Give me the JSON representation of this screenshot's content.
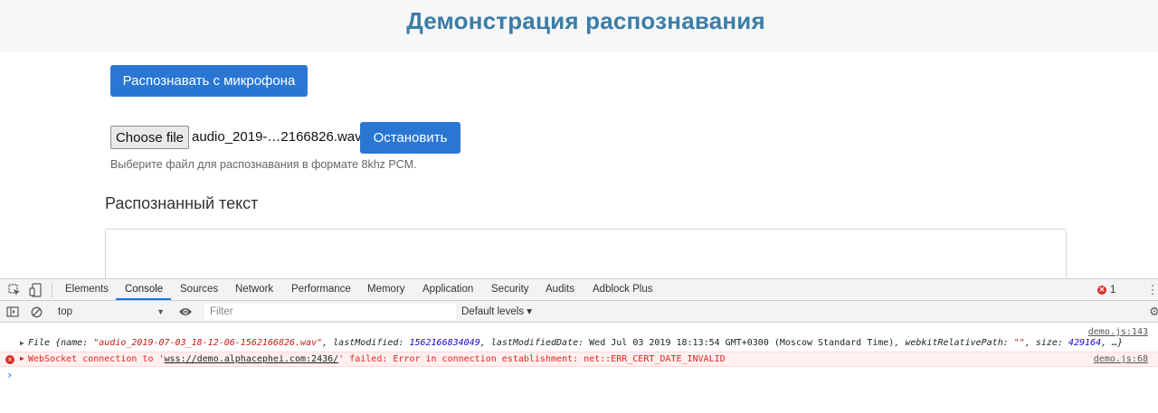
{
  "page": {
    "title": "Демонстрация распознавания",
    "mic_button": "Распознавать с микрофона",
    "choose_file_button": "Choose file",
    "file_name": "audio_2019-…2166826.wav",
    "stop_button": "Остановить",
    "file_hint": "Выберите файл для распознавания в формате 8khz PCM.",
    "result_heading": "Распознанный текст",
    "result_text": ""
  },
  "devtools": {
    "tabs": [
      "Elements",
      "Console",
      "Sources",
      "Network",
      "Performance",
      "Memory",
      "Application",
      "Security",
      "Audits",
      "Adblock Plus"
    ],
    "active_tab": "Console",
    "error_count": "1",
    "toolbar": {
      "context": "top",
      "filter_placeholder": "Filter",
      "levels": "Default levels ▾"
    },
    "console": {
      "log_source": "demo.js:143",
      "log": {
        "prefix": "File {",
        "k_name": "name: ",
        "v_name": "\"audio_2019-07-03_18-12-06-1562166826.wav\"",
        "k_last": ", lastModified: ",
        "v_last": "1562166834049",
        "k_lastdate": ", lastModifiedDate: ",
        "v_lastdate": "Wed Jul 03 2019 18:13:54 GMT+0300 (Moscow Standard Time)",
        "k_rel": ", webkitRelativePath: ",
        "v_rel": "\"\"",
        "k_size": ", size: ",
        "v_size": "429164",
        "suffix": ", …}"
      },
      "error": {
        "before": "WebSocket connection to '",
        "url": "wss://demo.alphacephei.com:2436/",
        "after": "' failed: Error in connection establishment: net::ERR_CERT_DATE_INVALID",
        "source": "demo.js:68"
      },
      "prompt": "›"
    }
  },
  "colors": {
    "title": "#3a7da8",
    "primary_button": "#2a77d3",
    "error_text": "#e0251b",
    "error_bg": "#fff0f0",
    "console_string": "#c41a16",
    "console_number": "#1c00cf",
    "active_tab_underline": "#1a73e8"
  },
  "icons": {
    "devtools": [
      "inspect-icon",
      "device-toolbar-icon",
      "more-icon",
      "sidebar-toggle-icon",
      "clear-console-icon",
      "eye-icon",
      "gear-icon",
      "error-icon"
    ]
  }
}
